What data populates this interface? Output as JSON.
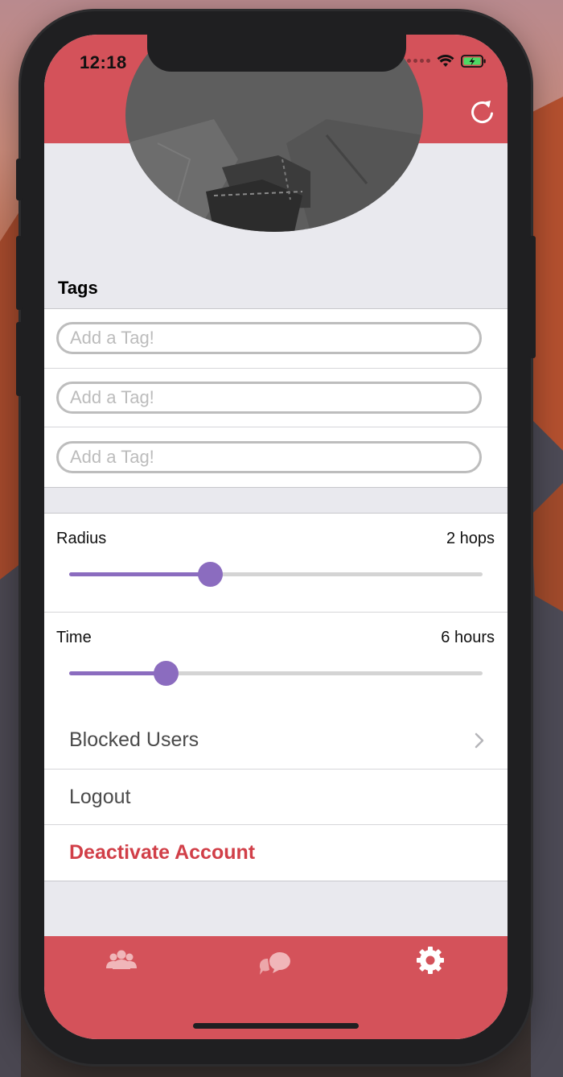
{
  "status_bar": {
    "time": "12:18"
  },
  "header": {
    "title": "Settings"
  },
  "tags_section": {
    "title": "Tags",
    "fields": [
      {
        "placeholder": "Add a Tag!",
        "value": ""
      },
      {
        "placeholder": "Add a Tag!",
        "value": ""
      },
      {
        "placeholder": "Add a Tag!",
        "value": ""
      }
    ]
  },
  "sliders": {
    "radius": {
      "label": "Radius",
      "value_text": "2 hops",
      "fraction": 0.34
    },
    "time": {
      "label": "Time",
      "value_text": "6 hours",
      "fraction": 0.234
    }
  },
  "menu": {
    "blocked_users": "Blocked Users",
    "logout": "Logout",
    "deactivate": "Deactivate Account"
  },
  "colors": {
    "brand": "#d4525a",
    "slider_accent": "#8b6cbf",
    "destructive": "#d13f48"
  },
  "icons": {
    "refresh": "refresh-icon",
    "chevron": "chevron-right-icon",
    "tabs": [
      "people-icon",
      "chat-bubbles-icon",
      "gear-icon"
    ]
  }
}
